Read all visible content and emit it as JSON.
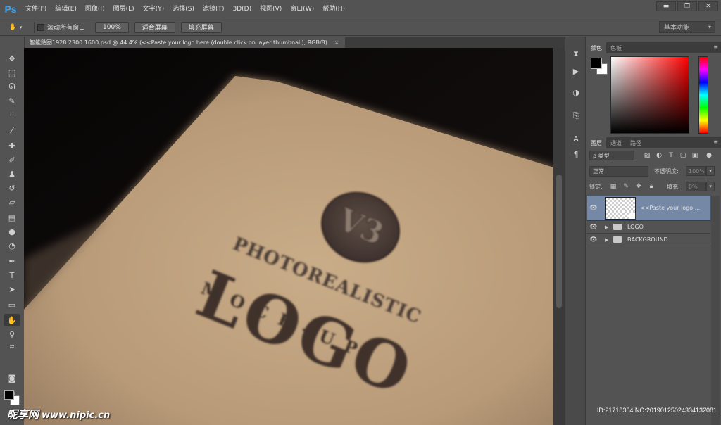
{
  "app": {
    "logo": "Ps",
    "menu": [
      "文件(F)",
      "编辑(E)",
      "图像(I)",
      "图层(L)",
      "文字(Y)",
      "选择(S)",
      "滤镜(T)",
      "3D(D)",
      "视图(V)",
      "窗口(W)",
      "帮助(H)"
    ],
    "window_controls": {
      "minimize": "▬",
      "restore": "❐",
      "close": "✕"
    }
  },
  "options_bar": {
    "scroll_all_windows": "滚动所有窗口",
    "zoom_100": "100%",
    "fit_screen": "适合屏幕",
    "fill_screen": "填充屏幕",
    "workspace": "基本功能"
  },
  "document": {
    "tab_title": "智能贴图1928 2300 1600.psd @ 44.4% (<<Paste your logo here (double click on layer thumbnail), RGB/8)",
    "close": "×"
  },
  "mockup": {
    "badge": "V3",
    "line1": "PHOTOREALISTIC",
    "line2": "LOGO",
    "line3": "MOCK-UP"
  },
  "color_panel": {
    "tabs": [
      "颜色",
      "色板"
    ]
  },
  "layers_panel": {
    "tabs": [
      "图层",
      "通道",
      "路径"
    ],
    "filter": "ρ 类型",
    "blend_mode": "正常",
    "opacity_label": "不透明度:",
    "opacity_value": "100%",
    "lock_label": "锁定:",
    "fill_label": "填充:",
    "fill_value": "0%",
    "layers": [
      {
        "name": "<<Paste your logo ..."
      },
      {
        "name": "LOGO"
      },
      {
        "name": "BACKGROUND"
      }
    ]
  },
  "watermark": {
    "left": "昵享网",
    "url": "www.nipic.cn",
    "right": "ID:21718364 NO:20190125024334132081"
  }
}
